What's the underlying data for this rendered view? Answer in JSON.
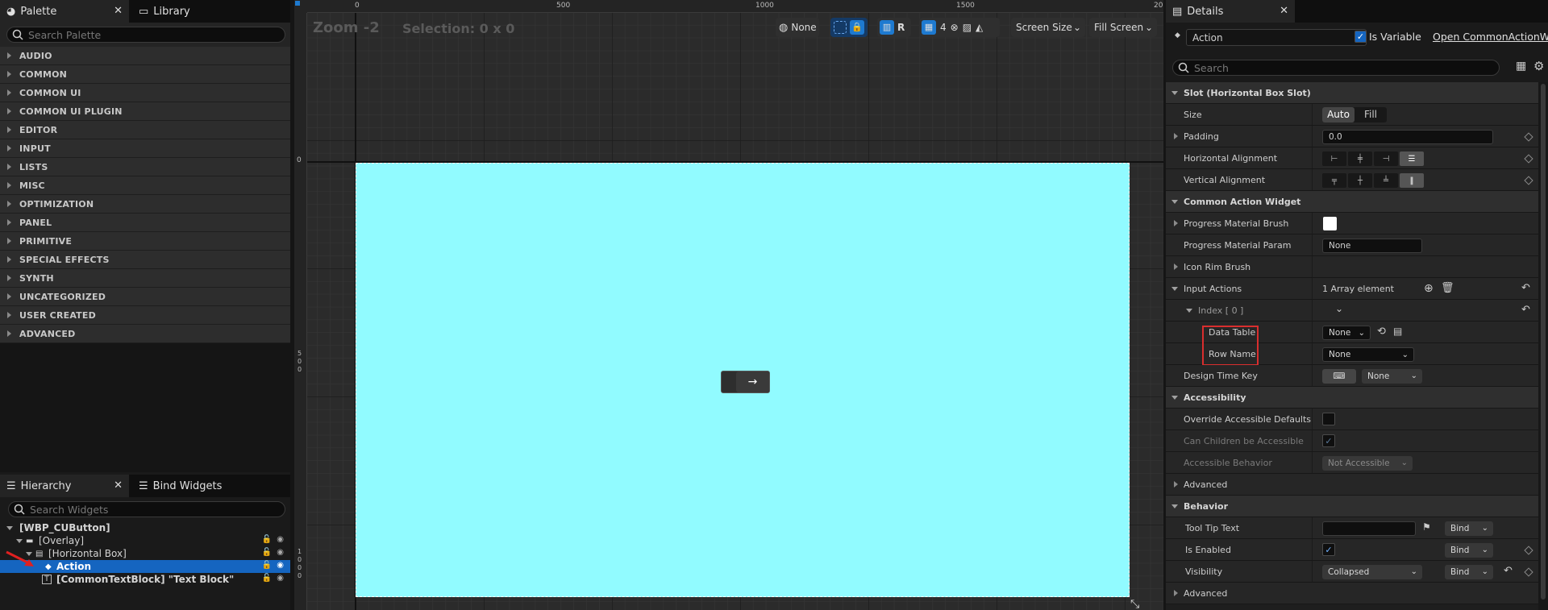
{
  "left": {
    "palette_tab": "Palette",
    "library_tab": "Library",
    "palette_search_placeholder": "Search Palette",
    "categories": [
      "AUDIO",
      "COMMON",
      "COMMON UI",
      "COMMON UI PLUGIN",
      "EDITOR",
      "INPUT",
      "LISTS",
      "MISC",
      "OPTIMIZATION",
      "PANEL",
      "PRIMITIVE",
      "SPECIAL EFFECTS",
      "SYNTH",
      "UNCATEGORIZED",
      "USER CREATED",
      "ADVANCED"
    ],
    "hierarchy_tab": "Hierarchy",
    "bind_widgets_tab": "Bind Widgets",
    "hierarchy_search_placeholder": "Search Widgets",
    "tree": [
      "[WBP_CUButton]",
      "[Overlay]",
      "[Horizontal Box]",
      "Action",
      "[CommonTextBlock] \"Text Block\""
    ]
  },
  "canvas": {
    "zoom": "Zoom -2",
    "selection": "Selection: 0 x 0",
    "ruler_marks": [
      "0",
      "500",
      "1000",
      "1500",
      "20"
    ],
    "left_ruler_marks": [
      "0",
      "5\n0\n0",
      "1\n0\n0\n0"
    ],
    "toolbar": {
      "none_label": "None",
      "r_label": "R",
      "grid_value": "4",
      "screen_size": "Screen Size",
      "fill_screen": "Fill Screen"
    },
    "widget_arrow": "→",
    "preview_color": "#91fbff"
  },
  "details": {
    "tab": "Details",
    "name_value": "Action",
    "is_variable_label": "Is Variable",
    "open_link": "Open CommonActionWidget",
    "search_placeholder": "Search",
    "slot_section": "Slot (Horizontal Box Slot)",
    "size_label": "Size",
    "size_auto": "Auto",
    "size_fill": "Fill",
    "padding_label": "Padding",
    "padding_value": "0.0",
    "h_align_label": "Horizontal Alignment",
    "v_align_label": "Vertical Alignment",
    "caw_section": "Common Action Widget",
    "progress_brush_label": "Progress Material Brush",
    "progress_param_label": "Progress Material Param",
    "progress_param_value": "None",
    "icon_rim_label": "Icon Rim Brush",
    "input_actions_label": "Input Actions",
    "input_actions_value": "1 Array element",
    "index_label": "Index [ 0 ]",
    "data_table_label": "Data Table",
    "data_table_value": "None",
    "row_name_label": "Row Name",
    "row_name_value": "None",
    "design_key_label": "Design Time Key",
    "design_key_value": "None",
    "accessibility_section": "Accessibility",
    "override_label": "Override Accessible Defaults",
    "can_children_label": "Can Children be Accessible",
    "accessible_behavior_label": "Accessible Behavior",
    "accessible_behavior_value": "Not Accessible",
    "advanced_label": "Advanced",
    "behavior_section": "Behavior",
    "tooltip_label": "Tool Tip Text",
    "bind_label": "Bind",
    "is_enabled_label": "Is Enabled",
    "visibility_label": "Visibility",
    "visibility_value": "Collapsed",
    "advanced2_label": "Advanced"
  },
  "colors": {
    "accent": "#1565c0",
    "highlight": "#d92e2e",
    "check": "#6fb1ff"
  }
}
